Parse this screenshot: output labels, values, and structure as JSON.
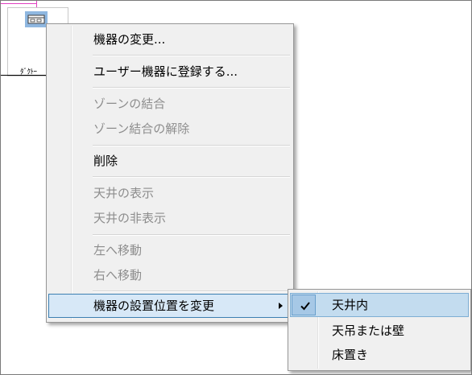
{
  "canvas": {
    "device_label": "ﾀﾞｸﾄｰ"
  },
  "context_menu": {
    "items": [
      {
        "label": "機器の変更...",
        "enabled": true
      },
      {
        "label": "ユーザー機器に登録する...",
        "enabled": true
      },
      {
        "label": "ゾーンの結合",
        "enabled": false
      },
      {
        "label": "ゾーン結合の解除",
        "enabled": false
      },
      {
        "label": "削除",
        "enabled": true
      },
      {
        "label": "天井の表示",
        "enabled": false
      },
      {
        "label": "天井の非表示",
        "enabled": false
      },
      {
        "label": "左へ移動",
        "enabled": false
      },
      {
        "label": "右へ移動",
        "enabled": false
      },
      {
        "label": "機器の設置位置を変更",
        "enabled": true,
        "has_submenu": true,
        "highlighted": true
      }
    ]
  },
  "submenu": {
    "items": [
      {
        "label": "天井内",
        "checked": true
      },
      {
        "label": "天吊または壁",
        "checked": false
      },
      {
        "label": "床置き",
        "checked": false
      }
    ]
  },
  "colors": {
    "menu_background": "#f0f0f0",
    "highlight_background": "#d7e8f7",
    "highlight_border": "#3c7fb1",
    "disabled_text": "#8d8d8d",
    "selection_line": "#e040c0"
  },
  "icons": {
    "device": "device-icon",
    "submenu_arrow": "chevron-right-icon",
    "check": "checkmark-icon"
  }
}
